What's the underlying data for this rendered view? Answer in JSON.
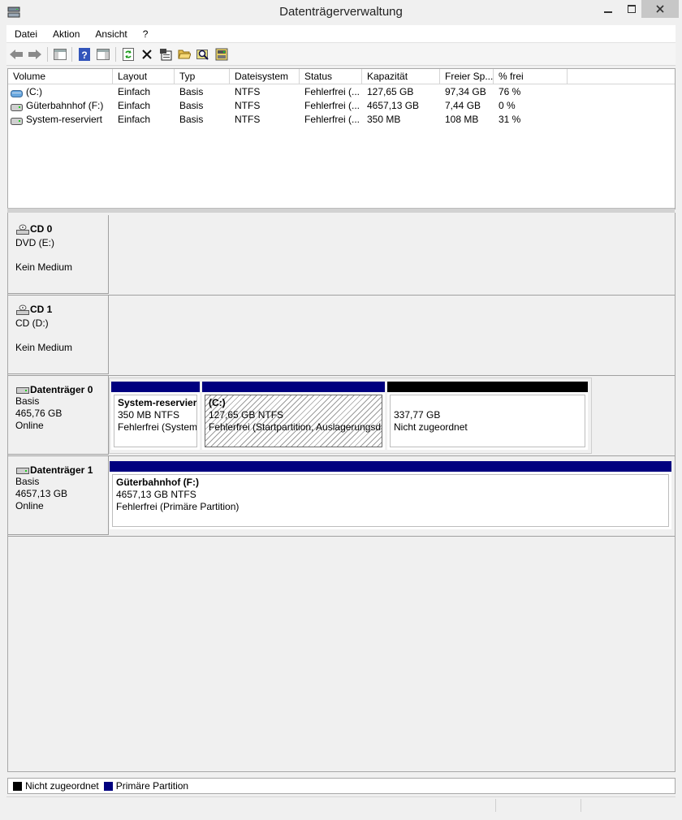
{
  "window": {
    "title": "Datenträgerverwaltung",
    "minimize_label": "—",
    "maximize_label": "☐",
    "close_label": "✕"
  },
  "menu": [
    "Datei",
    "Aktion",
    "Ansicht",
    "?"
  ],
  "toolbar": {
    "icons": [
      "back-arrow-icon",
      "forward-arrow-icon",
      "console-tree-icon",
      "help-icon",
      "properties-view-icon",
      "refresh-icon",
      "delete-icon",
      "properties-icon",
      "open-folder-icon",
      "explore-icon",
      "rescan-disks-icon"
    ]
  },
  "volume_list": {
    "columns": [
      "Volume",
      "Layout",
      "Typ",
      "Dateisystem",
      "Status",
      "Kapazität",
      "Freier Sp...",
      "% frei"
    ],
    "rows": [
      {
        "volume": "(C:)",
        "layout": "Einfach",
        "typ": "Basis",
        "dateisystem": "NTFS",
        "status": "Fehlerfrei (...",
        "kapazitaet": "127,65 GB",
        "frei": "97,34 GB",
        "prozent": "76 %",
        "icon": "system-volume-icon"
      },
      {
        "volume": "Güterbahnhof (F:)",
        "layout": "Einfach",
        "typ": "Basis",
        "dateisystem": "NTFS",
        "status": "Fehlerfrei (...",
        "kapazitaet": "4657,13 GB",
        "frei": "7,44 GB",
        "prozent": "0 %",
        "icon": "volume-icon"
      },
      {
        "volume": "System-reserviert",
        "layout": "Einfach",
        "typ": "Basis",
        "dateisystem": "NTFS",
        "status": "Fehlerfrei (...",
        "kapazitaet": "350 MB",
        "frei": "108 MB",
        "prozent": "31 %",
        "icon": "volume-icon"
      }
    ]
  },
  "disks": [
    {
      "name": "CD 0",
      "line1": "DVD (E:)",
      "line2": "",
      "line3": "Kein Medium",
      "icon": "cd-drive-icon"
    },
    {
      "name": "CD 1",
      "line1": "CD (D:)",
      "line2": "",
      "line3": "Kein Medium",
      "icon": "cd-drive-icon"
    },
    {
      "name": "Datenträger 0",
      "line1": "Basis",
      "line2": "465,76 GB",
      "line3": "Online",
      "icon": "hard-disk-icon",
      "partitions": [
        {
          "title": "System-reservier",
          "size": "350 MB NTFS",
          "status": "Fehlerfrei (System,",
          "kind": "primary"
        },
        {
          "title": "(C:)",
          "size": "127,65 GB NTFS",
          "status": "Fehlerfrei (Startpartition, Auslagerungsdatei",
          "kind": "primary-selected"
        },
        {
          "title": "",
          "size": "337,77 GB",
          "status": "Nicht zugeordnet",
          "kind": "unallocated"
        }
      ]
    },
    {
      "name": "Datenträger 1",
      "line1": "Basis",
      "line2": "4657,13 GB",
      "line3": "Online",
      "icon": "hard-disk-icon",
      "partitions": [
        {
          "title": "Güterbahnhof  (F:)",
          "size": "4657,13 GB NTFS",
          "status": "Fehlerfrei (Primäre Partition)",
          "kind": "primary"
        }
      ]
    }
  ],
  "legend": [
    {
      "label": "Nicht zugeordnet",
      "color": "#000000"
    },
    {
      "label": "Primäre Partition",
      "color": "#00007f"
    }
  ],
  "colors": {
    "primary": "#00007f",
    "unallocated": "#000000"
  }
}
